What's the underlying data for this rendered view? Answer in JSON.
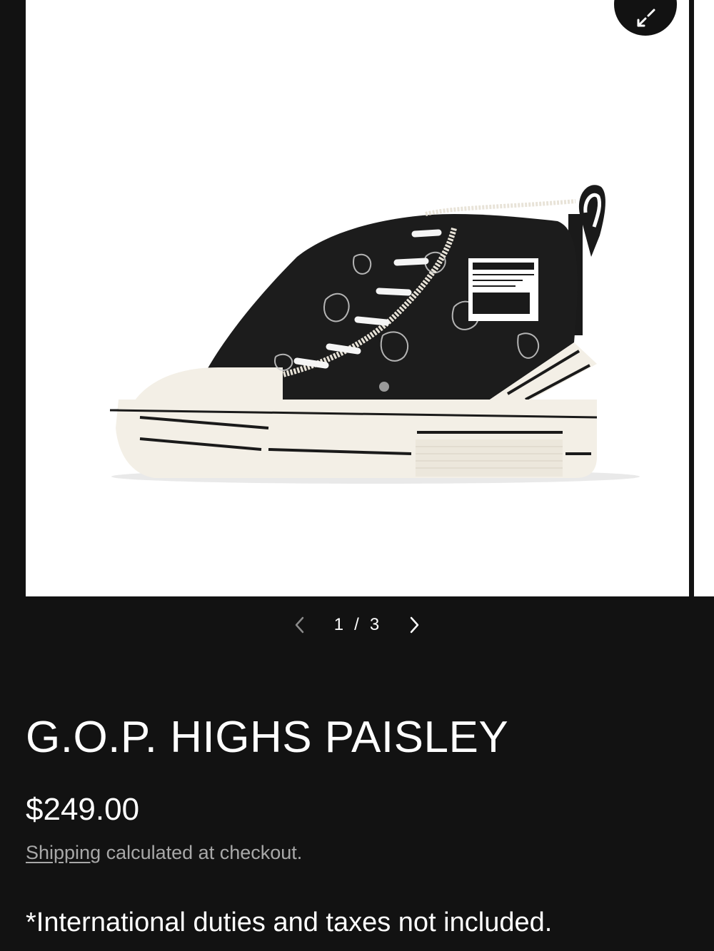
{
  "gallery": {
    "image_alt": "Black paisley high-top sneaker with frayed edges and cream platform sole",
    "counter_current": "1",
    "counter_separator": "/",
    "counter_total": "3",
    "icons": {
      "zoom": "expand-icon",
      "prev": "chevron-left-icon",
      "next": "chevron-right-icon"
    }
  },
  "product": {
    "title": "G.O.P. HIGHS PAISLEY",
    "price": "$249.00",
    "shipping_link": "Shipping",
    "shipping_text": " calculated at checkout.",
    "duties_note": "*International duties and taxes not included."
  },
  "colors": {
    "background": "#121212",
    "text": "#ffffff",
    "muted_text": "#a8a8a8",
    "media_background": "#ffffff"
  }
}
